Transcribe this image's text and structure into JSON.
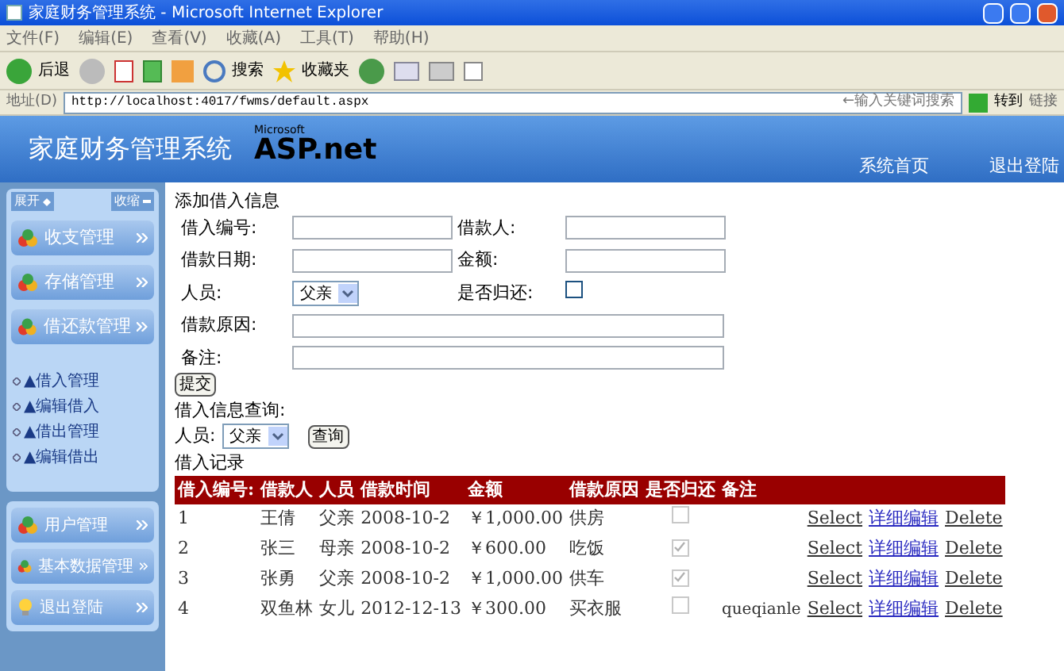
{
  "window": {
    "title": "家庭财务管理系统 - Microsoft Internet Explorer"
  },
  "menu": [
    "文件(F)",
    "编辑(E)",
    "查看(V)",
    "收藏(A)",
    "工具(T)",
    "帮助(H)"
  ],
  "toolbar": {
    "back": "后退",
    "search": "搜索",
    "favorites": "收藏夹"
  },
  "address_bar": {
    "label": "地址(D)",
    "url": "http://localhost:4017/fwms/default.aspx",
    "search_placeholder": "←输入关键词搜索",
    "go": "转到",
    "links": "链接"
  },
  "header": {
    "title": "家庭财务管理系统",
    "logo_small": "Microsoft",
    "logo": "ASP.net",
    "nav": [
      "系统首页",
      "退出登陆"
    ]
  },
  "sidebar": {
    "expand": "展开",
    "collapse": "收缩",
    "groups": [
      {
        "label": "收支管理",
        "kind": "group"
      },
      {
        "label": "存储管理",
        "kind": "group"
      },
      {
        "label": "借还款管理",
        "kind": "group"
      }
    ],
    "links": [
      "▲借入管理",
      "▲编辑借入",
      "▲借出管理",
      "▲编辑借出"
    ],
    "bottom_groups": [
      {
        "label": "用户管理",
        "kind": "group"
      },
      {
        "label": "基本数据管理",
        "kind": "group"
      },
      {
        "label": "退出登陆",
        "kind": "logout"
      }
    ]
  },
  "form": {
    "title": "添加借入信息",
    "id_label": "借入编号:",
    "borrower_label": "借款人:",
    "date_label": "借款日期:",
    "amount_label": "金额:",
    "person_label": "人员:",
    "person_value": "父亲",
    "returned_label": "是否归还:",
    "returned": false,
    "reason_label": "借款原因:",
    "note_label": "备注:",
    "submit": "提交"
  },
  "query": {
    "title": "借入信息查询:",
    "person_label": "人员:",
    "person_value": "父亲",
    "button": "查询"
  },
  "table": {
    "title": "借入记录",
    "columns": [
      "借入编号:",
      "借款人",
      "人员",
      "借款时间",
      "金额",
      "借款原因",
      "是否归还",
      "备注"
    ],
    "rows": [
      {
        "id": "1",
        "borrower": "王倩",
        "person": "父亲",
        "date": "2008-10-2",
        "amount": "￥1,000.00",
        "reason": "供房",
        "returned": false,
        "note": "",
        "select": "Select",
        "edit": "详细编辑",
        "delete": "Delete"
      },
      {
        "id": "2",
        "borrower": "张三",
        "person": "母亲",
        "date": "2008-10-2",
        "amount": "￥600.00",
        "reason": "吃饭",
        "returned": true,
        "note": "",
        "select": "Select",
        "edit": "详细编辑",
        "delete": "Delete"
      },
      {
        "id": "3",
        "borrower": "张勇",
        "person": "父亲",
        "date": "2008-10-2",
        "amount": "￥1,000.00",
        "reason": "供车",
        "returned": true,
        "note": "",
        "select": "Select",
        "edit": "详细编辑",
        "delete": "Delete"
      },
      {
        "id": "4",
        "borrower": "双鱼林",
        "person": "女儿",
        "date": "2012-12-13",
        "amount": "￥300.00",
        "reason": "买衣服",
        "returned": false,
        "note": "queqianle",
        "select": "Select",
        "edit": "详细编辑",
        "delete": "Delete"
      }
    ]
  }
}
